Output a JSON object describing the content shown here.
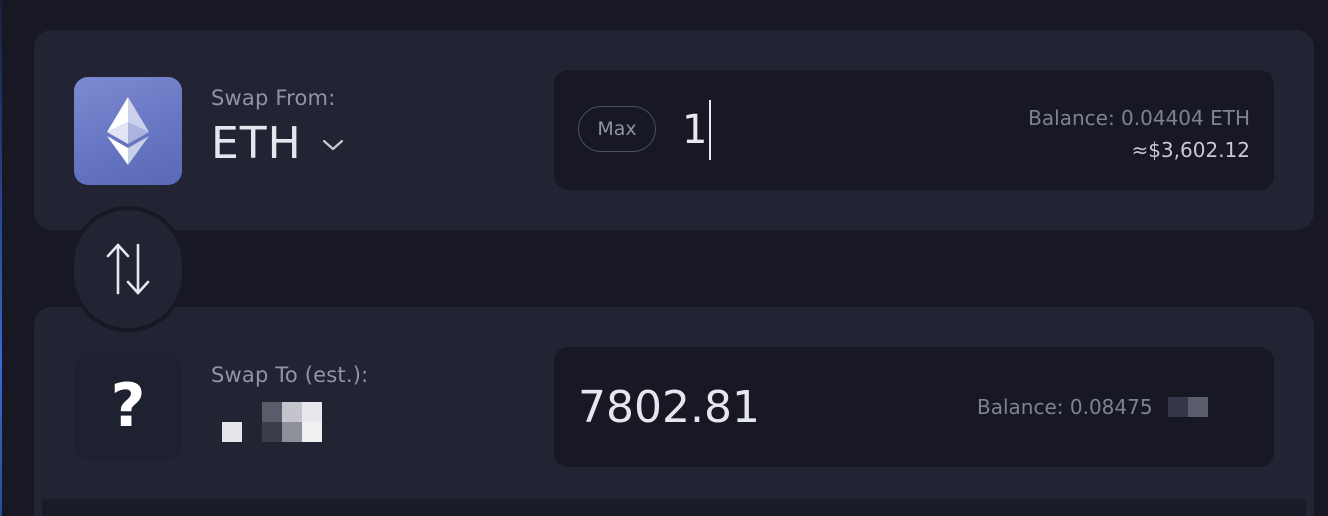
{
  "colors": {
    "background": "#181824",
    "card": "#222434",
    "input_box": "#171824",
    "eth_logo": "#6b7ac6",
    "text_primary": "#e6e7ee",
    "text_muted": "#9094a6"
  },
  "swap_from": {
    "label": "Swap From:",
    "token_symbol": "ETH",
    "token_icon": "ethereum-icon",
    "max_label": "Max",
    "amount": "1",
    "balance": "Balance: 0.04404 ETH",
    "usd_value": "≈$3,602.12"
  },
  "swap_toggle": {
    "icon": "swap-arrows-icon"
  },
  "swap_to": {
    "label": "Swap To (est.):",
    "token_icon": "question-mark-icon",
    "token_glyph": "?",
    "amount": "7802.81",
    "balance": "Balance: 0.08475"
  }
}
